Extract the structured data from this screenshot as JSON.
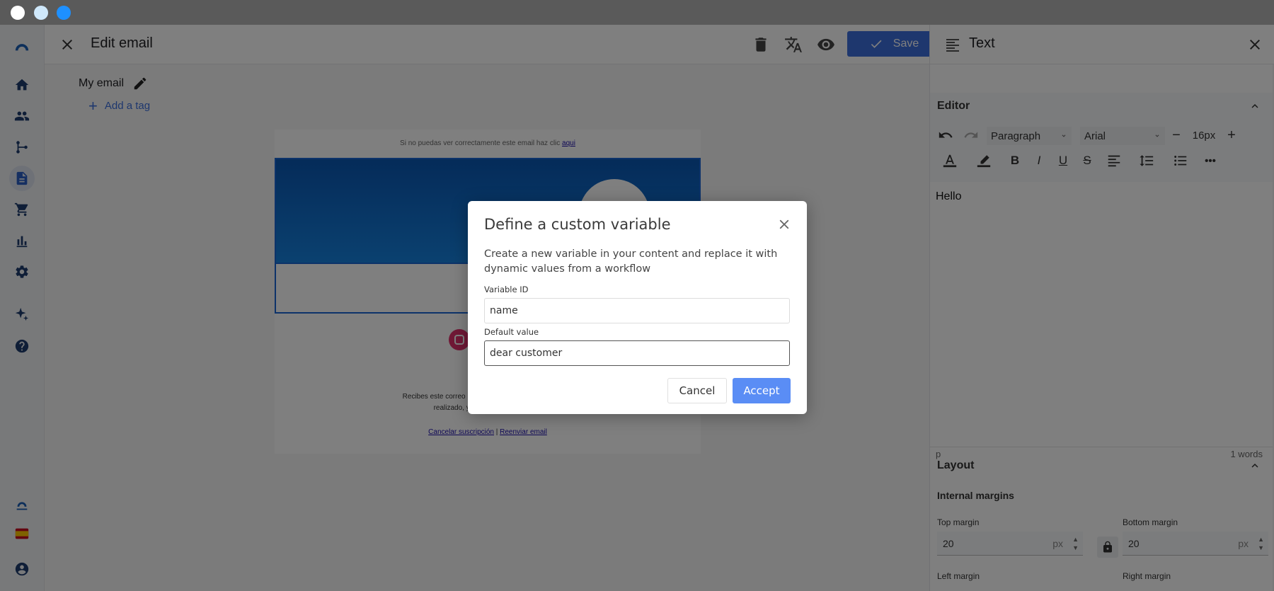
{
  "window": {
    "traffic_lights": [
      "#ffffff",
      "#cfe8fb",
      "#1e90ff"
    ]
  },
  "sidebar": {
    "items": [
      {
        "icon": "home-icon"
      },
      {
        "icon": "contacts-icon"
      },
      {
        "icon": "workflow-icon"
      },
      {
        "icon": "document-icon",
        "active": true
      },
      {
        "icon": "cart-icon"
      },
      {
        "icon": "reports-icon"
      },
      {
        "icon": "settings-icon"
      },
      {
        "icon": "sparkle-icon"
      },
      {
        "icon": "help-icon"
      }
    ],
    "footer": [
      {
        "icon": "connectif-logo-icon"
      },
      {
        "icon": "spain-flag-icon"
      },
      {
        "icon": "account-icon"
      }
    ]
  },
  "header": {
    "title": "Edit email",
    "save_label": "Save",
    "actions": [
      "delete-icon",
      "translate-icon",
      "preview-icon"
    ]
  },
  "canvas": {
    "email_name": "My email",
    "add_tag_label": "Add a tag",
    "preview": {
      "top_line_text": "Si no puedas ver correctamente este email haz clic ",
      "top_line_link": "aqui",
      "footer_line1": "Recibes este correo porque te has suscrito a esta lista",
      "footer_line2": "realizado, y creemos que la inform",
      "unsubscribe_link": "Cancelar suscripción",
      "separator": " | ",
      "forward_link": "Reenviar email"
    }
  },
  "panel": {
    "title": "Text",
    "editor_section": "Editor",
    "block_format": "Paragraph",
    "font_family": "Arial",
    "font_size": "16px",
    "content": "Hello",
    "status_path": "p",
    "word_count": "1 words",
    "layout_section": "Layout",
    "internal_margins": "Internal margins",
    "top_margin_label": "Top margin",
    "top_margin_value": "20",
    "bottom_margin_label": "Bottom margin",
    "bottom_margin_value": "20",
    "left_margin_label": "Left margin",
    "right_margin_label": "Right margin",
    "unit": "px"
  },
  "modal": {
    "title": "Define a custom variable",
    "description": "Create a new variable in your content and replace it with dynamic values from a workflow",
    "variable_id_label": "Variable ID",
    "variable_id_value": "name",
    "default_value_label": "Default value",
    "default_value_value": "dear customer",
    "cancel_label": "Cancel",
    "accept_label": "Accept"
  }
}
